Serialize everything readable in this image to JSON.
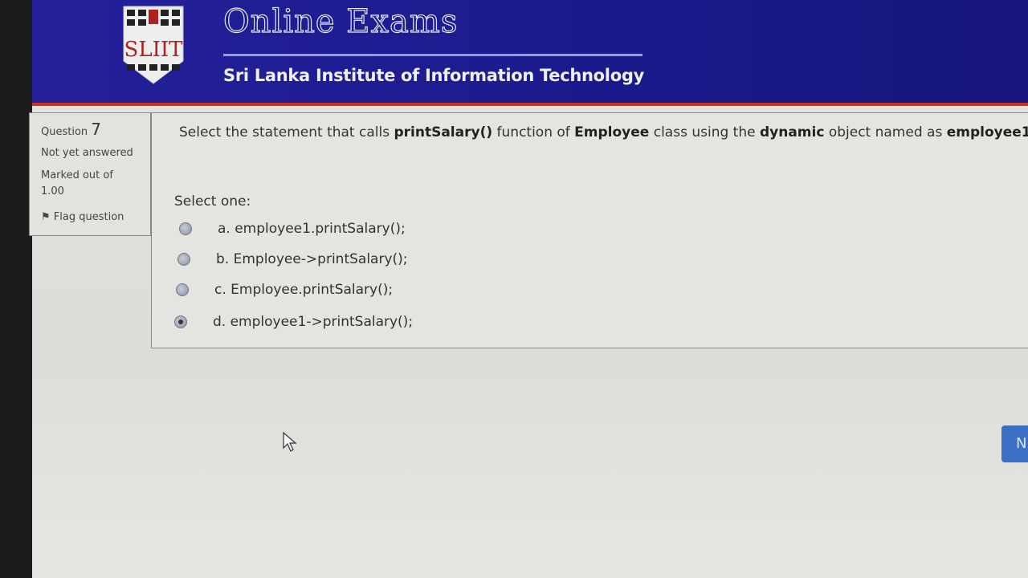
{
  "header": {
    "logo_text": "SLIIT",
    "title": "Online Exams",
    "subtitle": "Sri Lanka Institute of Information Technology"
  },
  "question_info": {
    "question_label": "Question",
    "question_number": "7",
    "status": "Not yet answered",
    "marked_label": "Marked out of",
    "marked_value": "1.00",
    "flag_label": "Flag question"
  },
  "question": {
    "text_parts": [
      "Select the statement that calls ",
      "printSalary()",
      " function of ",
      "Employee",
      " class using the ",
      "dynamic",
      " object named as ",
      "employee1"
    ],
    "select_label": "Select one:",
    "options": [
      {
        "label": "a. employee1.printSalary();",
        "checked": false
      },
      {
        "label": "b. Employee->printSalary();",
        "checked": false
      },
      {
        "label": "c. Employee.printSalary();",
        "checked": false
      },
      {
        "label": "d. employee1->printSalary();",
        "checked": true
      }
    ]
  },
  "navigation": {
    "next_label": "N"
  },
  "colors": {
    "header_blue": "#1a1a8c",
    "header_red": "#c8302a",
    "button_blue": "#3a6fc4"
  }
}
